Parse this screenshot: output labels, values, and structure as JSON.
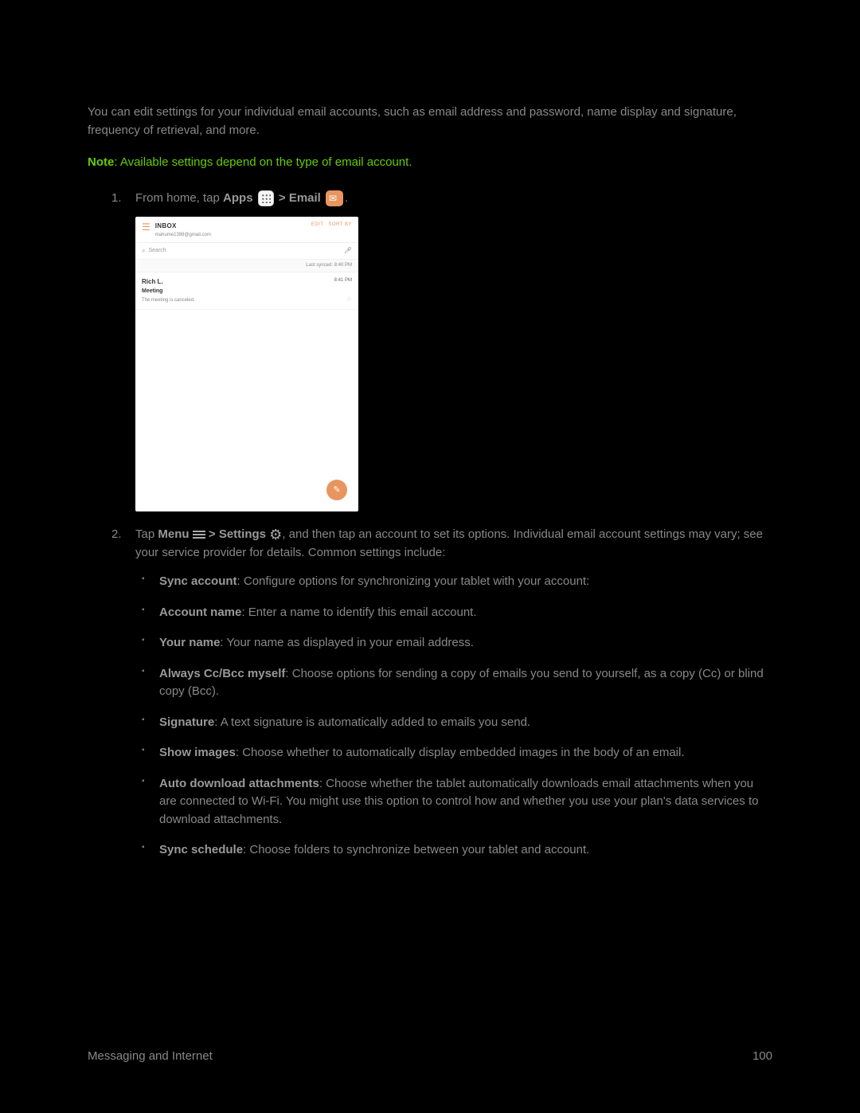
{
  "intro": "You can edit settings for your individual email accounts, such as email address and password, name display and signature, frequency of retrieval, and more.",
  "note": {
    "label": "Note",
    "text": ": Available settings depend on the type of email account."
  },
  "steps": {
    "s1": {
      "num": "1.",
      "prefix": "From home, tap ",
      "apps": "Apps",
      "gt": " > ",
      "email": "Email",
      "suffix": "."
    },
    "s2": {
      "num": "2.",
      "prefix": "Tap ",
      "menu": "Menu",
      "gt1": " > ",
      "settings": "Settings",
      "rest": ", and then tap an account to set its options. Individual email account settings may vary; see your service provider for details. Common settings include:"
    }
  },
  "screenshot": {
    "inbox": "INBOX",
    "account": "mahume1398@gmail.com",
    "edit": "EDIT",
    "sortby": "SORT BY",
    "search": "Search",
    "lastsync": "Last synced: 8:40 PM",
    "msg": {
      "from": "Rich L.",
      "subject": "Meeting",
      "preview": "The meeting is canceled.",
      "time": "8:41 PM"
    }
  },
  "bullets": {
    "b1": {
      "label": "Sync account",
      "text": ": Configure options for synchronizing your tablet with your account:"
    },
    "b2": {
      "label": "Account name",
      "text": ": Enter a name to identify this email account."
    },
    "b3": {
      "label": "Your name",
      "text": ": Your name as displayed in your email address."
    },
    "b4": {
      "label": "Always Cc/Bcc myself",
      "text": ": Choose options for sending a copy of emails you send to yourself, as a copy (Cc) or blind copy (Bcc)."
    },
    "b5": {
      "label": "Signature",
      "text": ": A text signature is automatically added to emails you send."
    },
    "b6": {
      "label": "Show images",
      "text": ": Choose whether to automatically display embedded images in the body of an email."
    },
    "b7": {
      "label": "Auto download attachments",
      "text": ": Choose whether the tablet automatically downloads email attachments when you are connected to Wi-Fi. You might use this option to control how and whether you use your plan's data services to download attachments."
    },
    "b8": {
      "label": "Sync schedule",
      "text": ": Choose folders to synchronize between your tablet and account."
    }
  },
  "footer": {
    "section": "Messaging and Internet",
    "page": "100"
  }
}
